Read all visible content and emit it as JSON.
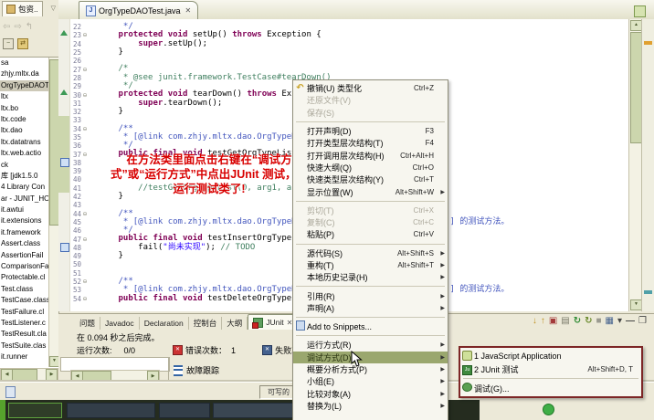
{
  "explorer": {
    "tab_label": "包资..",
    "selected": "OrgTypeDAOTest",
    "items": [
      "sa",
      "zhjy.mltx.da",
      "OrgTypeDAOTest",
      "ltx",
      "ltx.bo",
      "ltx.code",
      "ltx.dao",
      "ltx.datatrans",
      "ltx.web.actio",
      "ck",
      "库 [jdk1.5.0",
      "4 Library Con",
      "ar - JUNIT_HO",
      "it.awtui",
      "it.extensions",
      "it.framework",
      "Assert.class",
      "AssertionFail",
      "ComparisonFail",
      "Protectable.cl",
      "Test.class",
      "TestCase.class",
      "TestFailure.cl",
      "TestListener.c",
      "TestResult.cla",
      "TestSuite.clas",
      "it.runner"
    ]
  },
  "editor": {
    "tab_label": "OrgTypeDAOTest.java",
    "close_glyph": "✕",
    "annotation_lines": [
      "在方法类里面点击右键在“调试方",
      "式”或“运行方式”中点出JUnit 测试，就",
      "运行测试类了!"
    ],
    "lines": [
      {
        "n": "22",
        "seg": [
          [
            "j",
            "       */"
          ]
        ]
      },
      {
        "n": "23",
        "fold": 1,
        "mark": "tri",
        "seg": [
          [
            "p",
            "      "
          ],
          [
            "k",
            "protected"
          ],
          [
            "p",
            " "
          ],
          [
            "k",
            "void"
          ],
          [
            "p",
            " setUp() "
          ],
          [
            "k",
            "throws"
          ],
          [
            "p",
            " Exception {"
          ]
        ]
      },
      {
        "n": "24",
        "seg": [
          [
            "p",
            "          "
          ],
          [
            "k",
            "super"
          ],
          [
            "p",
            ".setUp();"
          ]
        ]
      },
      {
        "n": "25",
        "seg": [
          [
            "p",
            "      }"
          ]
        ]
      },
      {
        "n": "26",
        "seg": []
      },
      {
        "n": "27",
        "fold": 1,
        "seg": [
          [
            "c",
            "      /*"
          ]
        ]
      },
      {
        "n": "28",
        "seg": [
          [
            "c",
            "       * @see junit.framework.TestCase#tearDown()"
          ]
        ]
      },
      {
        "n": "29",
        "seg": [
          [
            "c",
            "       */"
          ]
        ]
      },
      {
        "n": "30",
        "fold": 1,
        "mark": "tri",
        "seg": [
          [
            "p",
            "      "
          ],
          [
            "k",
            "protected"
          ],
          [
            "p",
            " "
          ],
          [
            "k",
            "void"
          ],
          [
            "p",
            " tearDown() "
          ],
          [
            "k",
            "throws"
          ],
          [
            "p",
            " Exception {"
          ]
        ]
      },
      {
        "n": "31",
        "seg": [
          [
            "p",
            "          "
          ],
          [
            "k",
            "super"
          ],
          [
            "p",
            ".tearDown();"
          ]
        ]
      },
      {
        "n": "32",
        "seg": [
          [
            "p",
            "      }"
          ]
        ]
      },
      {
        "n": "33",
        "seg": []
      },
      {
        "n": "34",
        "fold": 1,
        "seg": [
          [
            "j",
            "      /**"
          ]
        ]
      },
      {
        "n": "35",
        "seg": [
          [
            "j",
            "       * [@link com.zhjy.mltx.dao.OrgTypeDAO#getOrgTypeList()] 的测试方法。"
          ]
        ]
      },
      {
        "n": "36",
        "seg": [
          [
            "j",
            "       */"
          ]
        ]
      },
      {
        "n": "37",
        "fold": 1,
        "seg": [
          [
            "p",
            "      "
          ],
          [
            "k",
            "public"
          ],
          [
            "p",
            " "
          ],
          [
            "k",
            "final"
          ],
          [
            "p",
            " "
          ],
          [
            "k",
            "void"
          ],
          [
            "p",
            " testGetOrgTypeList() {"
          ]
        ]
      },
      {
        "n": "38",
        "mark": "blue",
        "seg": []
      },
      {
        "n": "39",
        "seg": []
      },
      {
        "n": "40",
        "seg": []
      },
      {
        "n": "41",
        "seg": [
          [
            "c",
            "          //testGetOrgTypeList(0, arg1, arg2);"
          ]
        ]
      },
      {
        "n": "42",
        "seg": [
          [
            "p",
            "      }"
          ]
        ]
      },
      {
        "n": "43",
        "seg": []
      },
      {
        "n": "44",
        "fold": 1,
        "seg": [
          [
            "j",
            "      /**"
          ]
        ]
      },
      {
        "n": "45",
        "seg": [
          [
            "j",
            "       * [@link com.zhjy.mltx.dao.OrgTypeDAO#insertOrgTypeInfo(OrgTypeVO)] 的测试方法。"
          ]
        ]
      },
      {
        "n": "46",
        "seg": [
          [
            "j",
            "       */"
          ]
        ]
      },
      {
        "n": "47",
        "fold": 1,
        "seg": [
          [
            "p",
            "      "
          ],
          [
            "k",
            "public"
          ],
          [
            "p",
            " "
          ],
          [
            "k",
            "final"
          ],
          [
            "p",
            " "
          ],
          [
            "k",
            "void"
          ],
          [
            "p",
            " testInsertOrgTypeInfoOrgTypeVO() {"
          ]
        ]
      },
      {
        "n": "48",
        "mark": "blue",
        "seg": [
          [
            "p",
            "          fail("
          ],
          [
            "s",
            "\"尚未实现\""
          ],
          [
            "p",
            "); "
          ],
          [
            "c",
            "// TODO"
          ]
        ]
      },
      {
        "n": "49",
        "seg": [
          [
            "p",
            "      }"
          ]
        ]
      },
      {
        "n": "50",
        "seg": []
      },
      {
        "n": "51",
        "seg": []
      },
      {
        "n": "52",
        "fold": 1,
        "seg": [
          [
            "j",
            "      /**"
          ]
        ]
      },
      {
        "n": "53",
        "seg": [
          [
            "j",
            "       * [@link com.zhjy.mltx.dao.OrgTypeDAO#deleteOrgTypeInfo(OrgTypeVO)] 的测试方法。"
          ]
        ]
      },
      {
        "n": "54",
        "fold": 1,
        "seg": [
          [
            "p",
            "      "
          ],
          [
            "k",
            "public"
          ],
          [
            "p",
            " "
          ],
          [
            "k",
            "final"
          ],
          [
            "p",
            " "
          ],
          [
            "k",
            "void"
          ],
          [
            "p",
            " testDeleteOrgTypeInfo…"
          ]
        ]
      }
    ]
  },
  "context_menu": {
    "items": [
      {
        "icon": "undo",
        "label": "撤销(U) 类型化",
        "shortcut": "Ctrl+Z"
      },
      {
        "label": "还原文件(V)",
        "disabled": true
      },
      {
        "label": "保存(S)",
        "disabled": true
      },
      {
        "sep": true
      },
      {
        "label": "打开声明(D)",
        "shortcut": "F3"
      },
      {
        "label": "打开类型层次结构(T)",
        "shortcut": "F4"
      },
      {
        "label": "打开调用层次结构(H)",
        "shortcut": "Ctrl+Alt+H"
      },
      {
        "label": "快速大纲(Q)",
        "shortcut": "Ctrl+O"
      },
      {
        "label": "快速类型层次结构(Y)",
        "shortcut": "Ctrl+T"
      },
      {
        "label": "显示位置(W)",
        "shortcut": "Alt+Shift+W",
        "arrow": true
      },
      {
        "sep": true
      },
      {
        "label": "剪切(T)",
        "shortcut": "Ctrl+X",
        "disabled": true
      },
      {
        "label": "复制(C)",
        "shortcut": "Ctrl+C",
        "disabled": true
      },
      {
        "label": "粘贴(P)",
        "shortcut": "Ctrl+V"
      },
      {
        "sep": true
      },
      {
        "label": "源代码(S)",
        "shortcut": "Alt+Shift+S",
        "arrow": true
      },
      {
        "label": "重构(T)",
        "shortcut": "Alt+Shift+T",
        "arrow": true
      },
      {
        "label": "本地历史记录(H)",
        "arrow": true
      },
      {
        "sep": true
      },
      {
        "label": "引用(R)",
        "arrow": true
      },
      {
        "label": "声明(A)",
        "arrow": true
      },
      {
        "sep": true
      },
      {
        "icon": "snippet",
        "label": "Add to Snippets..."
      },
      {
        "sep": true
      },
      {
        "label": "运行方式(R)",
        "arrow": true
      },
      {
        "label": "调试方式(D)",
        "arrow": true,
        "selected": true
      },
      {
        "label": "概要分析方式(P)",
        "arrow": true
      },
      {
        "label": "小组(E)",
        "arrow": true
      },
      {
        "label": "比较对象(A)",
        "arrow": true
      },
      {
        "label": "替换为(L)",
        "arrow": true
      }
    ]
  },
  "debug_submenu": {
    "items": [
      {
        "icon": "jsapp",
        "label": "1 JavaScript Application"
      },
      {
        "icon": "junit",
        "label": "2 JUnit 测试",
        "shortcut": "Alt+Shift+D, T"
      },
      {
        "sep": true
      },
      {
        "icon": "bug",
        "label": "调试(G)..."
      }
    ]
  },
  "bottom_panel": {
    "tabs": [
      "问题",
      "Javadoc",
      "Declaration",
      "控制台",
      "大纲",
      "JUnit"
    ],
    "active_tab": "JUnit",
    "finished_text": "在 0.094 秒之后完成。",
    "runs_label": "运行次数:",
    "runs_value": "0/0",
    "errors_label": "错误次数：",
    "errors_value": "1",
    "failures_label": "失败次数：",
    "failure_trace_label": "故障跟踪",
    "toolbar_icons": [
      {
        "name": "next-failure-icon",
        "glyph": "↓",
        "color": "#c19322"
      },
      {
        "name": "previous-failure-icon",
        "glyph": "↑",
        "color": "#c19322"
      },
      {
        "name": "failures-only-icon",
        "glyph": "▣",
        "color": "#a33a3a"
      },
      {
        "name": "scroll-lock-icon",
        "glyph": "▤",
        "color": "#7a7a6a"
      },
      {
        "name": "rerun-test-icon",
        "glyph": "↻",
        "color": "#2e8b33"
      },
      {
        "name": "rerun-failed-icon",
        "glyph": "↻",
        "color": "#6b8b2e"
      },
      {
        "name": "stop-icon",
        "glyph": "■",
        "color": "#9a9a90"
      },
      {
        "name": "test-hierarchy-icon",
        "glyph": "▦",
        "color": "#44618e"
      },
      {
        "name": "view-menu-icon",
        "glyph": "▾",
        "color": "#444444"
      },
      {
        "name": "minimize-icon",
        "glyph": "—",
        "color": "#444444"
      },
      {
        "name": "maximize-icon",
        "glyph": "❐",
        "color": "#444444"
      }
    ]
  },
  "status_bar": {
    "writable": "可写的"
  },
  "colors": {
    "menu_selection": "#9aa76e",
    "submenu_border": "#7d2626",
    "annotation_red": "#d80000",
    "error_red": "#cc3333",
    "failure_blue": "#44618e",
    "chrome_beige": "#ece9d8"
  }
}
